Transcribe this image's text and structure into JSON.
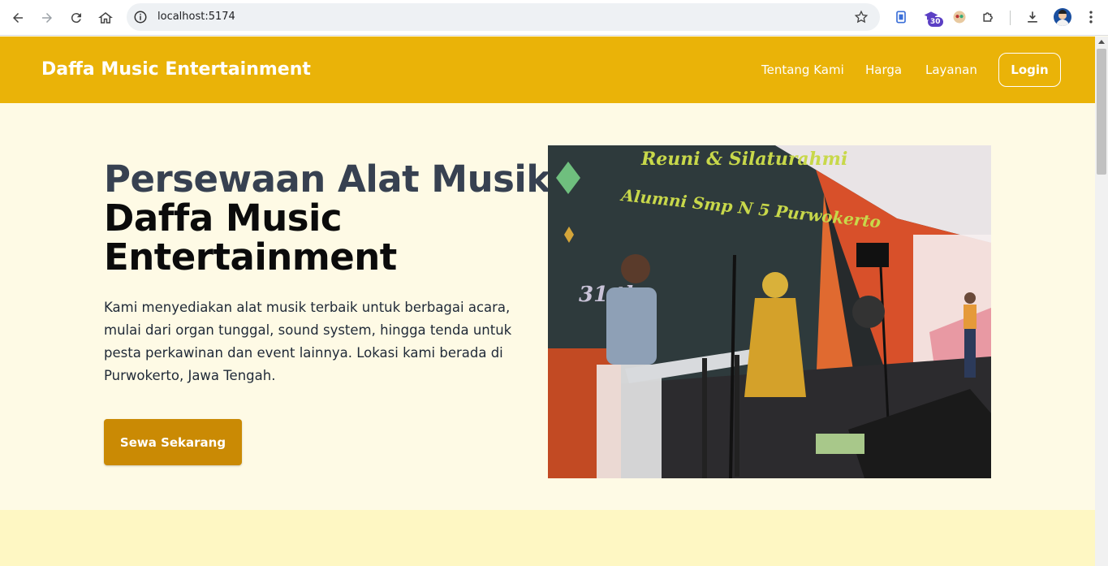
{
  "browser": {
    "url": "localhost:5174",
    "extension_badge": "30",
    "icons": [
      "back-arrow-icon",
      "forward-arrow-icon",
      "reload-icon",
      "home-icon",
      "site-info-icon",
      "bookmark-star-icon",
      "extension-icon",
      "puzzle-icon",
      "download-icon",
      "menu-kebab-icon"
    ]
  },
  "header": {
    "brand": "Daffa Music Entertainment",
    "nav": [
      "Tentang Kami",
      "Harga",
      "Layanan"
    ],
    "login": "Login",
    "color": "#eab308"
  },
  "hero": {
    "title_line1": "Persewaan Alat Musik",
    "title_line2": "Daffa Music Entertainment",
    "description": "Kami menyediakan alat musik terbaik untuk berbagai acara, mulai dari organ tunggal, sound system, hingga tenda untuk pesta perkawinan dan event lainnya. Lokasi kami berada di Purwokerto, Jawa Tengah.",
    "cta": "Sewa Sekarang",
    "cta_color": "#ca8a04",
    "photo_banner_line1": "Reuni & Silaturahmi",
    "photo_banner_line2": "Alumni Smp N 5 Purwokerto",
    "photo_banner_line3": "31 th"
  }
}
